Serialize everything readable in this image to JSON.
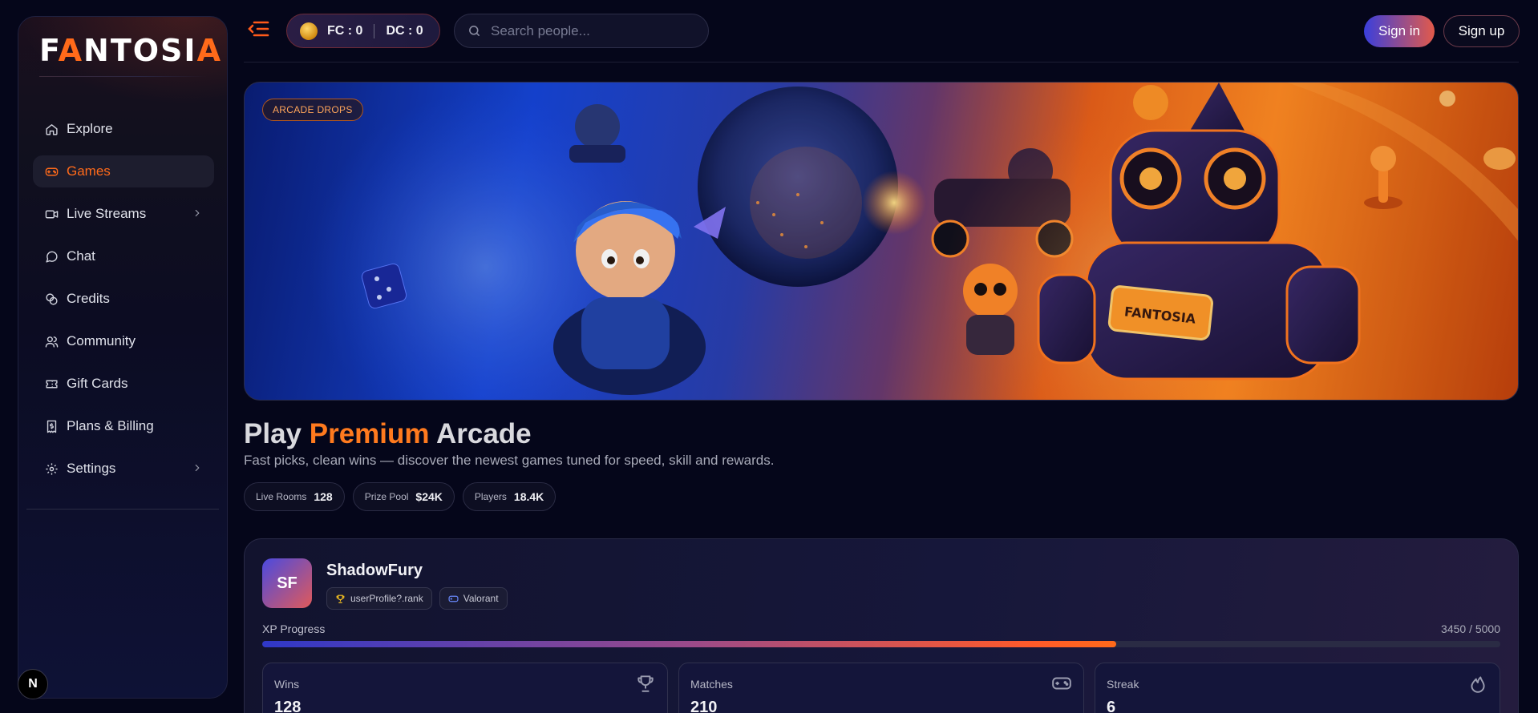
{
  "brand": {
    "logo_text_1": "F",
    "logo_a1": "A",
    "logo_text_2": "NTOSI",
    "logo_a2": "A",
    "accent": "#ff6a1a"
  },
  "sidebar": {
    "items": [
      {
        "label": "Explore",
        "icon": "home-icon",
        "active": false,
        "has_chevron": false
      },
      {
        "label": "Games",
        "icon": "gamepad-icon",
        "active": true,
        "has_chevron": false
      },
      {
        "label": "Live Streams",
        "icon": "video-icon",
        "active": false,
        "has_chevron": true
      },
      {
        "label": "Chat",
        "icon": "chat-icon",
        "active": false,
        "has_chevron": false
      },
      {
        "label": "Credits",
        "icon": "coins-icon",
        "active": false,
        "has_chevron": false
      },
      {
        "label": "Community",
        "icon": "users-icon",
        "active": false,
        "has_chevron": false
      },
      {
        "label": "Gift Cards",
        "icon": "ticket-icon",
        "active": false,
        "has_chevron": false
      },
      {
        "label": "Plans & Billing",
        "icon": "receipt-icon",
        "active": false,
        "has_chevron": false
      },
      {
        "label": "Settings",
        "icon": "gear-icon",
        "active": false,
        "has_chevron": true
      }
    ],
    "dev_badge": "N"
  },
  "topbar": {
    "fc": "FC : 0",
    "dc": "DC : 0",
    "search_placeholder": "Search people...",
    "signin": "Sign in",
    "signup": "Sign up"
  },
  "hero": {
    "tag": "ARCADE DROPS",
    "robot_chest_text": "FANTOSIA"
  },
  "heading": {
    "part1": "Play",
    "accent": "Premium",
    "part2": "Arcade",
    "subtitle": "Fast picks, clean wins — discover the newest games tuned for speed, skill and rewards."
  },
  "stats": [
    {
      "label": "Live Rooms",
      "value": "128"
    },
    {
      "label": "Prize Pool",
      "value": "$24K"
    },
    {
      "label": "Players",
      "value": "18.4K"
    }
  ],
  "profile": {
    "initials": "SF",
    "name": "ShadowFury",
    "rank_badge": "userProfile?.rank",
    "game_badge": "Valorant",
    "xp_label": "XP Progress",
    "xp_text": "3450 / 5000",
    "xp_current": 3450,
    "xp_max": 5000,
    "metrics": [
      {
        "label": "Wins",
        "value": "128",
        "icon": "trophy-icon"
      },
      {
        "label": "Matches",
        "value": "210",
        "icon": "gamepad-icon"
      },
      {
        "label": "Streak",
        "value": "6",
        "icon": "flame-icon"
      }
    ]
  }
}
